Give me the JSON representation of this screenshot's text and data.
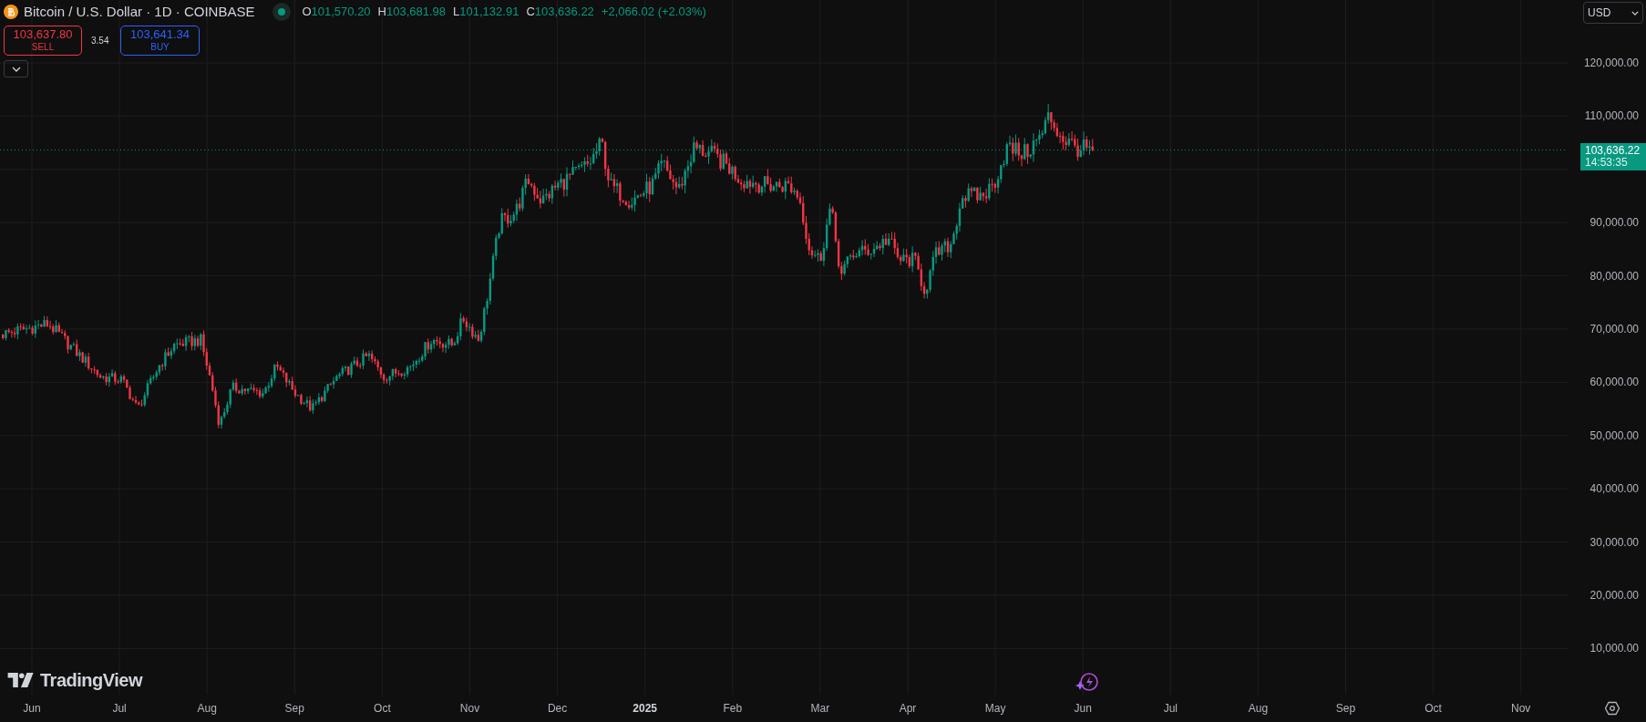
{
  "header": {
    "symbol": "Bitcoin / U.S. Dollar · 1D · COINBASE",
    "market_open": true,
    "ohlc": [
      {
        "label": "O",
        "value": "101,570.20"
      },
      {
        "label": "H",
        "value": "103,681.98"
      },
      {
        "label": "L",
        "value": "101,132.91"
      },
      {
        "label": "C",
        "value": "103,636.22"
      }
    ],
    "change": "+2,066.02 (+2.03%)"
  },
  "trade": {
    "sell": {
      "price": "103,637.80",
      "label": "SELL"
    },
    "spread": "3.54",
    "buy": {
      "price": "103,641.34",
      "label": "BUY"
    }
  },
  "currency": "USD",
  "last_price": {
    "price": "103,636.22",
    "countdown": "14:53:35"
  },
  "price_axis": [
    "120,000.00",
    "110,000.00"
  ],
  "price_axis_below_tag": [
    "90,000.00",
    "80,000.00",
    "70,000.00",
    "60,000.00",
    "50,000.00",
    "40,000.00",
    "30,000.00",
    "20,000.00",
    "10,000.00"
  ],
  "time_axis": [
    {
      "label": "Jun",
      "kind": "month"
    },
    {
      "label": "Jul",
      "kind": "month"
    },
    {
      "label": "Aug",
      "kind": "month"
    },
    {
      "label": "Sep",
      "kind": "month"
    },
    {
      "label": "Oct",
      "kind": "month"
    },
    {
      "label": "Nov",
      "kind": "month"
    },
    {
      "label": "Dec",
      "kind": "month"
    },
    {
      "label": "2025",
      "kind": "year"
    },
    {
      "label": "Feb",
      "kind": "month"
    },
    {
      "label": "Mar",
      "kind": "month"
    },
    {
      "label": "Apr",
      "kind": "month"
    },
    {
      "label": "May",
      "kind": "month"
    },
    {
      "label": "Jun",
      "kind": "month"
    },
    {
      "label": "Jul",
      "kind": "month"
    },
    {
      "label": "Aug",
      "kind": "month"
    },
    {
      "label": "Sep",
      "kind": "month"
    },
    {
      "label": "Oct",
      "kind": "month"
    },
    {
      "label": "Nov",
      "kind": "month"
    }
  ],
  "logo": "TradingView"
}
